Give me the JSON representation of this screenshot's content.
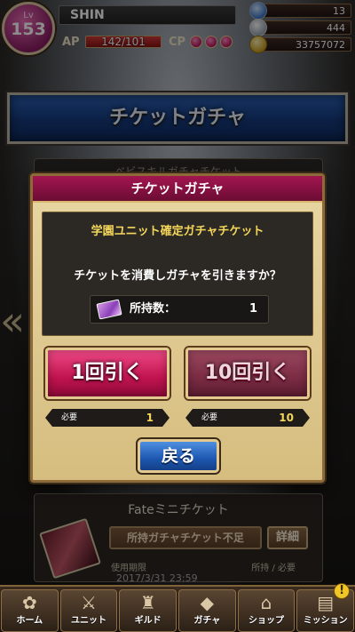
{
  "player": {
    "level_label": "Lv",
    "level": "153",
    "name": "SHIN",
    "ap_label": "AP",
    "ap_text": "142/101",
    "ap_fraction": 1.0,
    "cp_label": "CP",
    "cp_count": 3
  },
  "currencies": [
    {
      "icon": "crystal-icon",
      "value": "13"
    },
    {
      "icon": "orb-icon",
      "value": "444"
    },
    {
      "icon": "gold-coin-icon",
      "value": "33757072"
    }
  ],
  "banner": {
    "title": "チケットガチャ"
  },
  "background_cards": {
    "top_card_text": "ベビスキルガチャチケット",
    "fate_card": {
      "title": "Fateミニチケット",
      "shortage_label": "所持ガチャチケット不足",
      "detail_label": "詳細",
      "expiry_label": "使用期限",
      "owned_required_label": "所持 / 必要",
      "expiry_date": "2017/3/31 23:59"
    },
    "side_arrow": "«"
  },
  "modal": {
    "title": "チケットガチャ",
    "ticket_name": "学園ユニット確定ガチャチケット",
    "question": "チケットを消費しガチャを引きますか？",
    "owned_label": "所持数：",
    "owned_count": "1",
    "pull_1_label": "1回引く",
    "pull_10_label": "10回引く",
    "required_label": "必要",
    "pull_1_required": "1",
    "pull_10_required": "10",
    "back_label": "戻る"
  },
  "bottom_nav": [
    {
      "label": "ホーム",
      "icon": "home-icon",
      "glyph": "✿",
      "notify": ""
    },
    {
      "label": "ユニット",
      "icon": "unit-icon",
      "glyph": "⚔",
      "notify": ""
    },
    {
      "label": "ギルド",
      "icon": "guild-icon",
      "glyph": "♜",
      "notify": ""
    },
    {
      "label": "ガチャ",
      "icon": "gacha-icon",
      "glyph": "◆",
      "notify": ""
    },
    {
      "label": "ショップ",
      "icon": "shop-icon",
      "glyph": "⌂",
      "notify": ""
    },
    {
      "label": "ミッション",
      "icon": "mission-icon",
      "glyph": "▤",
      "notify": "!"
    }
  ]
}
